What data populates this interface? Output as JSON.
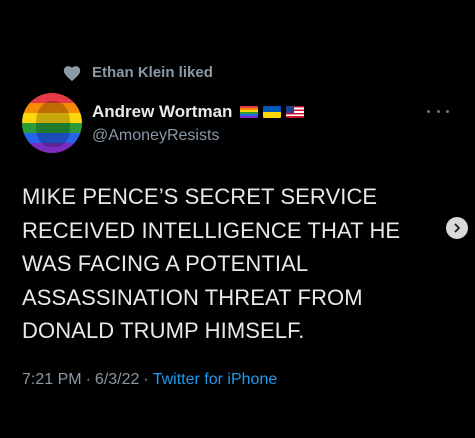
{
  "social_context": {
    "icon": "heart-icon",
    "text": "Ethan Klein liked"
  },
  "author": {
    "display_name": "Andrew Wortman",
    "handle": "@AmoneyResists",
    "avatar": "rainbow-avatar",
    "flags": [
      "rainbow-flag",
      "ukraine-flag",
      "us-flag"
    ]
  },
  "tweet": {
    "text": "MIKE PENCE’S SECRET SERVICE\nRECEIVED INTELLIGENCE THAT HE\nWAS FACING A POTENTIAL\nASSASSINATION THREAT FROM\nDONALD TRUMP HIMSELF."
  },
  "meta": {
    "time": "7:21 PM",
    "separator": "·",
    "date": "6/3/22",
    "source": "Twitter for iPhone"
  },
  "colors": {
    "background": "#000000",
    "text_primary": "#e7e9ea",
    "text_secondary": "#8b98a5",
    "link": "#1d9bf0"
  }
}
